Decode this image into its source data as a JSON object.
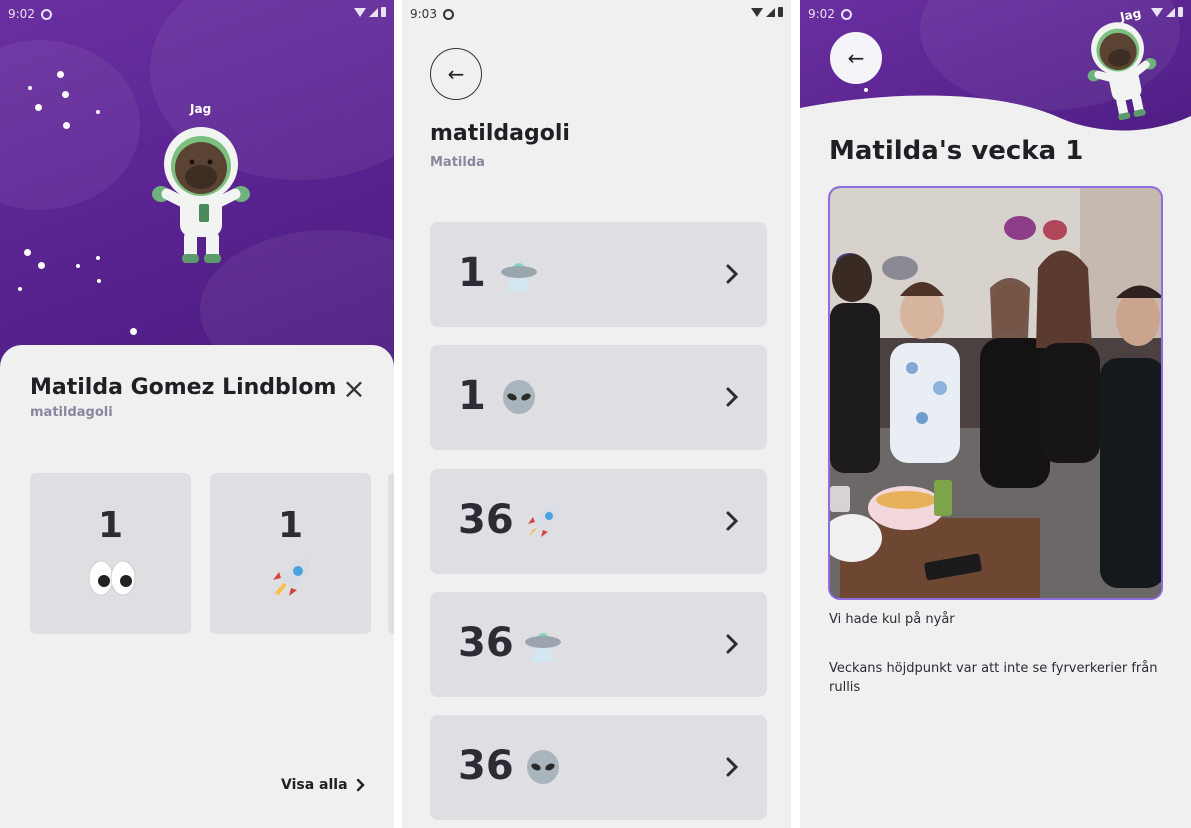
{
  "panel1": {
    "status": {
      "time": "9:02"
    },
    "avatar_label": "Jag",
    "profile": {
      "full_name": "Matilda Gomez Lindblom",
      "username": "matildagoli"
    },
    "reactions": [
      {
        "count": "1",
        "icon": "eyes-emoji"
      },
      {
        "count": "1",
        "icon": "rocket-emoji"
      }
    ],
    "show_all_label": "Visa alla",
    "colors": {
      "space_bg": "#5c2593",
      "card_bg": "#dfdee2",
      "sheet_bg": "#f0f0f0"
    }
  },
  "panel2": {
    "status": {
      "time": "9:03"
    },
    "username": "matildagoli",
    "display_name": "Matilda",
    "rows": [
      {
        "count": "1",
        "icon": "ufo-emoji"
      },
      {
        "count": "1",
        "icon": "alien-emoji"
      },
      {
        "count": "36",
        "icon": "rocket-emoji"
      },
      {
        "count": "36",
        "icon": "ufo-emoji"
      },
      {
        "count": "36",
        "icon": "alien-emoji"
      }
    ]
  },
  "panel3": {
    "status": {
      "time": "9:02"
    },
    "avatar_label": "Jag",
    "title": "Matilda's vecka 1",
    "caption": "Vi hade kul på nyår",
    "highlight": "Veckans höjdpunkt var att inte se fyrverkerier från rullis",
    "colors": {
      "photo_border": "#8d6ce0"
    }
  }
}
